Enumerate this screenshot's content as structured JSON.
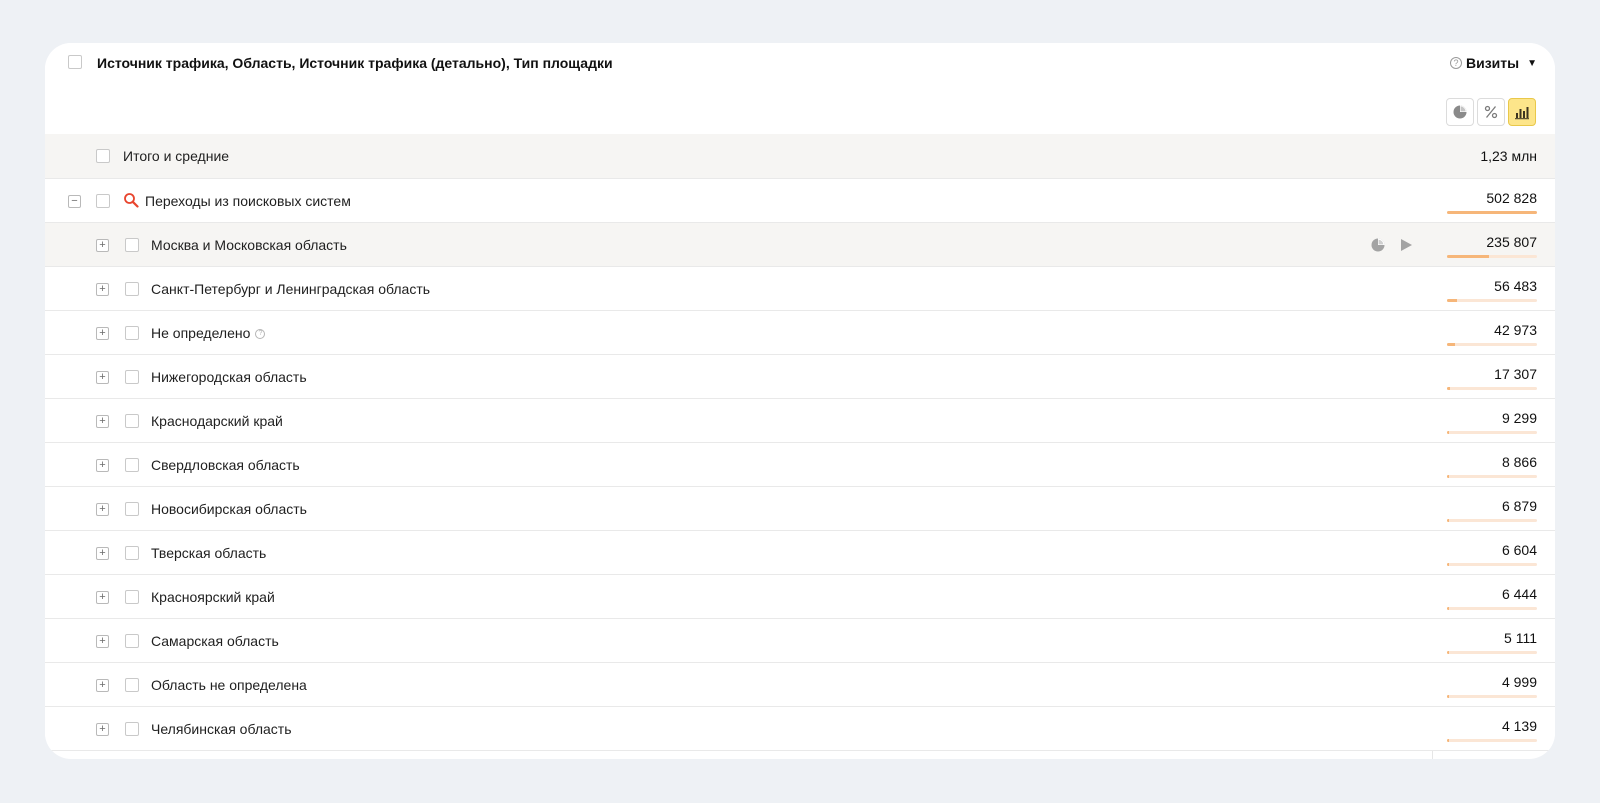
{
  "header": {
    "title": "Источник трафика, Область, Источник трафика (детально), Тип площадки",
    "metric": "Визиты",
    "metric_caret": "▼",
    "help_glyph": "?",
    "view_buttons": [
      {
        "icon": "pie-chart-icon",
        "active": false
      },
      {
        "icon": "percent-icon",
        "active": false
      },
      {
        "icon": "bar-chart-icon",
        "active": true
      }
    ]
  },
  "total": {
    "label": "Итого и средние",
    "value": "1,23 млн"
  },
  "group": {
    "label": "Переходы из поисковых систем",
    "value": "502 828",
    "icon": "search-icon",
    "expander": "−",
    "bar_fraction": 1.0
  },
  "rows": [
    {
      "label": "Москва и Московская область",
      "value": "235 807",
      "bar_fraction": 0.469,
      "hover": true
    },
    {
      "label": "Санкт-Петербург и Ленинградская область",
      "value": "56 483",
      "bar_fraction": 0.112
    },
    {
      "label": "Не определено",
      "value": "42 973",
      "bar_fraction": 0.085,
      "help": true
    },
    {
      "label": "Нижегородская область",
      "value": "17 307",
      "bar_fraction": 0.034
    },
    {
      "label": "Краснодарский край",
      "value": "9 299",
      "bar_fraction": 0.018
    },
    {
      "label": "Свердловская область",
      "value": "8 866",
      "bar_fraction": 0.018
    },
    {
      "label": "Новосибирская область",
      "value": "6 879",
      "bar_fraction": 0.014
    },
    {
      "label": "Тверская область",
      "value": "6 604",
      "bar_fraction": 0.013
    },
    {
      "label": "Красноярский край",
      "value": "6 444",
      "bar_fraction": 0.013
    },
    {
      "label": "Самарская область",
      "value": "5 111",
      "bar_fraction": 0.01
    },
    {
      "label": "Область не определена",
      "value": "4 999",
      "bar_fraction": 0.01
    },
    {
      "label": "Челябинская область",
      "value": "4 139",
      "bar_fraction": 0.008
    }
  ],
  "expand_glyph": "+",
  "colors": {
    "bar_fill": "#f6b679",
    "bar_track": "#fbe6d5",
    "active_button": "#fde58a",
    "search_icon": "#e8452e"
  }
}
